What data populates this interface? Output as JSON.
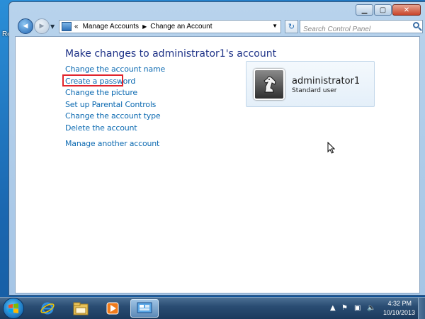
{
  "desktop": {
    "icon_label": "Re"
  },
  "window": {
    "controls": {
      "minimize": "▁",
      "maximize": "▢",
      "close": "✕"
    }
  },
  "nav": {
    "back_icon": "◀",
    "forward_icon": "▶",
    "address": {
      "prefix": "«",
      "crumbs": [
        "Manage Accounts",
        "Change an Account"
      ],
      "separator": "▶"
    },
    "search_placeholder": "Search Control Panel"
  },
  "page": {
    "title": "Make changes to administrator1's account",
    "links": [
      "Change the account name",
      "Create a password",
      "Change the picture",
      "Set up Parental Controls",
      "Change the account type",
      "Delete the account"
    ],
    "manage_another": "Manage another account",
    "highlighted_link_index": 1,
    "highlight_color": "#e0242c",
    "link_color": "#0e6bb2",
    "title_color": "#1e3287"
  },
  "account": {
    "name": "administrator1",
    "type": "Standard user",
    "picture_icon": "chess-knight-icon"
  },
  "taskbar": {
    "pinned": [
      "internet-explorer-icon",
      "windows-explorer-icon",
      "media-player-icon",
      "control-panel-icon"
    ],
    "clock": {
      "time": "4:32 PM",
      "date": "10/10/2013"
    }
  }
}
